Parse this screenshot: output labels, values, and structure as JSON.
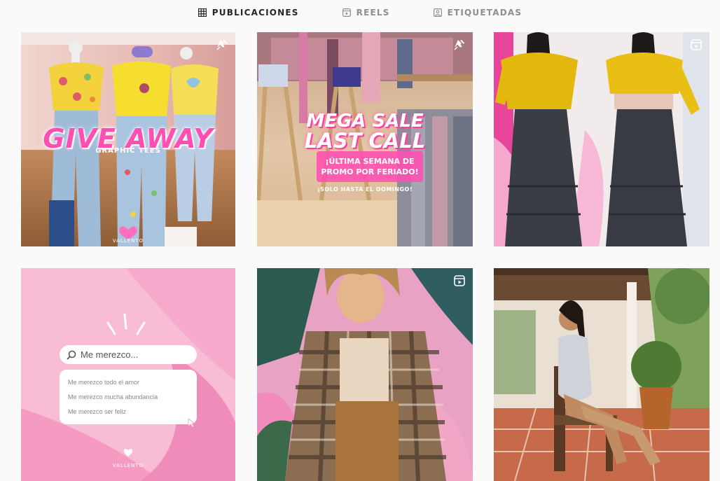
{
  "tabs": [
    {
      "label": "PUBLICACIONES",
      "icon": "grid-icon",
      "active": true
    },
    {
      "label": "REELS",
      "icon": "reels-icon",
      "active": false
    },
    {
      "label": "ETIQUETADAS",
      "icon": "tagged-icon",
      "active": false
    }
  ],
  "posts": [
    {
      "kind": "image",
      "badge": "pin-icon",
      "headline": "GIVE AWAY",
      "subline": "GRAPHIC TEES",
      "brand": "VALLENTO"
    },
    {
      "kind": "image",
      "badge": "pin-icon",
      "headline_1": "MEGA SALE",
      "headline_2": "LAST CALL",
      "promo_1": "¡ÚLTIMA SEMANA DE",
      "promo_2": "PROMO POR FERIADO!",
      "promo_sub": "¡SOLO HASTA EL DOMINGO!"
    },
    {
      "kind": "reel",
      "badge": "reel-icon"
    },
    {
      "kind": "image",
      "badge": "",
      "search_text": "Me merezco...",
      "suggestions": [
        "Me merezco todo el amor",
        "Me merezco mucha abundancia",
        "Me merezco ser feliz"
      ],
      "brand": "VALLENTO"
    },
    {
      "kind": "reel",
      "badge": "reel-icon"
    },
    {
      "kind": "image",
      "badge": ""
    }
  ],
  "colors": {
    "accent_pink": "#ff4fb3",
    "active_tab": "#262626",
    "inactive_tab": "#8e8e8e"
  }
}
